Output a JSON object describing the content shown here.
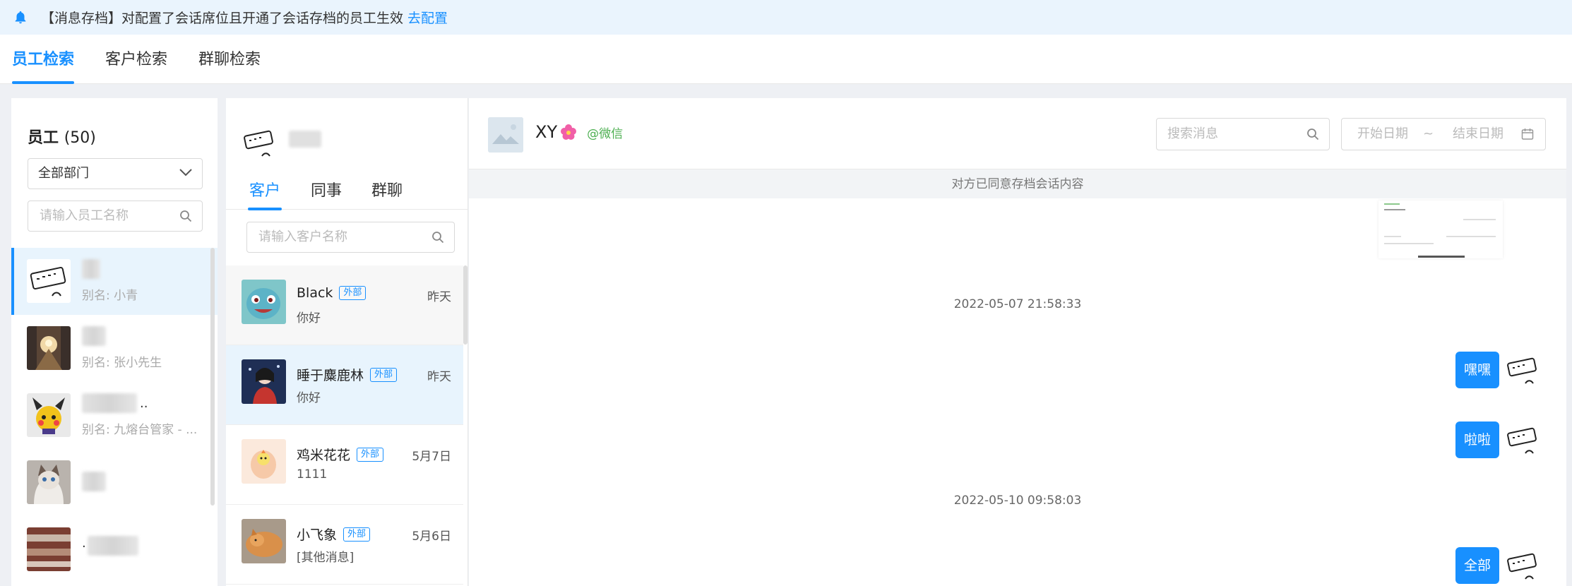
{
  "banner": {
    "text": "【消息存档】对配置了会话席位且开通了会话存档的员工生效",
    "link": "去配置"
  },
  "tabs": [
    {
      "label": "员工检索",
      "active": true
    },
    {
      "label": "客户检索",
      "active": false
    },
    {
      "label": "群聊检索",
      "active": false
    }
  ],
  "employee_panel": {
    "title": "员工",
    "count": "(50)",
    "dept_select": "全部部门",
    "search_placeholder": "请输入员工名称",
    "items": [
      {
        "name_suffix": "",
        "alias": "别名: 小青",
        "active": true
      },
      {
        "name_suffix": "",
        "alias": "别名: 张小先生",
        "active": false
      },
      {
        "name_suffix": "..",
        "alias": "别名: 九熔台管家 - ...",
        "active": false
      },
      {
        "name_suffix": "",
        "alias": "",
        "active": false
      },
      {
        "name_suffix": ".",
        "alias": "",
        "active": false
      }
    ]
  },
  "customer_panel": {
    "tabs": [
      {
        "label": "客户",
        "active": true
      },
      {
        "label": "同事",
        "active": false
      },
      {
        "label": "群聊",
        "active": false
      }
    ],
    "search_placeholder": "请输入客户名称",
    "items": [
      {
        "name": "Black",
        "tag": "外部",
        "time": "昨天",
        "msg": "你好"
      },
      {
        "name": "睡于麋鹿林",
        "tag": "外部",
        "time": "昨天",
        "msg": "你好"
      },
      {
        "name": "鸡米花花",
        "tag": "外部",
        "time": "5月7日",
        "msg": "1111"
      },
      {
        "name": "小飞象",
        "tag": "外部",
        "time": "5月6日",
        "msg": "[其他消息]"
      }
    ]
  },
  "chat": {
    "contact_name": "XY",
    "contact_source": "@微信",
    "search_placeholder": "搜索消息",
    "start_date_placeholder": "开始日期",
    "date_separator": "~",
    "end_date_placeholder": "结束日期",
    "consent_notice": "对方已同意存档会话内容",
    "timestamps": [
      "2022-05-07 21:58:33",
      "2022-05-10 09:58:03"
    ],
    "messages": [
      "嘿嘿",
      "啦啦",
      "全部"
    ]
  },
  "colors": {
    "accent": "#1890ff",
    "banner_bg": "#eaf4fd",
    "active_row": "#e8f4fd",
    "wechat_green": "#4caf50"
  }
}
